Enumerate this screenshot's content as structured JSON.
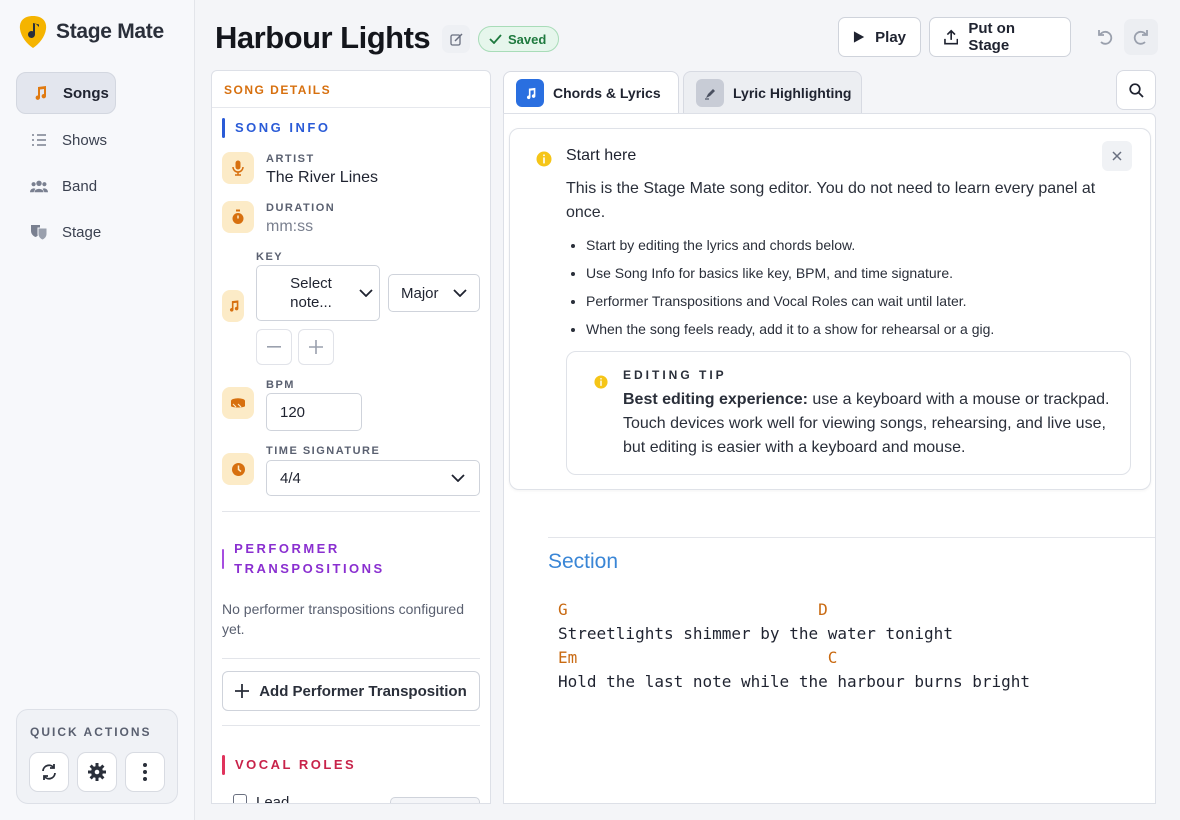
{
  "app": {
    "name": "Stage Mate",
    "colors": {
      "accent": "#d7700f",
      "logo": "#f5b400",
      "info": "#f5c518",
      "link": "#3a86d6"
    }
  },
  "sidebar": {
    "items": [
      {
        "label": "Songs",
        "icon": "music-note-icon",
        "active": true
      },
      {
        "label": "Shows",
        "icon": "list-icon",
        "active": false
      },
      {
        "label": "Band",
        "icon": "people-icon",
        "active": false
      },
      {
        "label": "Stage",
        "icon": "theater-masks-icon",
        "active": false
      }
    ],
    "quick_actions": {
      "title": "QUICK ACTIONS",
      "buttons": [
        "refresh-icon",
        "gear-icon",
        "more-vertical-icon"
      ]
    }
  },
  "header": {
    "title": "Harbour Lights",
    "saved_label": "Saved",
    "play_label": "Play",
    "stage_label": "Put on Stage"
  },
  "song_details": {
    "heading": "SONG DETAILS",
    "song_info": {
      "heading": "SONG INFO",
      "artist_label": "ARTIST",
      "artist_value": "The River Lines",
      "duration_label": "DURATION",
      "duration_placeholder": "mm:ss",
      "key_label": "KEY",
      "key_note": "Select note...",
      "key_mode": "Major",
      "bpm_label": "BPM",
      "bpm_value": "120",
      "time_sig_label": "TIME SIGNATURE",
      "time_sig_value": "4/4"
    },
    "performer": {
      "heading": "PERFORMER TRANSPOSITIONS",
      "empty": "No performer transpositions configured yet.",
      "add_label": "Add Performer Transposition"
    },
    "vocal": {
      "heading": "VOCAL ROLES",
      "first_role": "Lead"
    }
  },
  "tabs": [
    {
      "label": "Chords & Lyrics",
      "active": true
    },
    {
      "label": "Lyric Highlighting",
      "active": false
    }
  ],
  "callout": {
    "title": "Start here",
    "body": "This is the Stage Mate song editor. You do not need to learn every panel at once.",
    "bullets": [
      "Start by editing the lyrics and chords below.",
      "Use Song Info for basics like key, BPM, and time signature.",
      "Performer Transpositions and Vocal Roles can wait until later.",
      "When the song feels ready, add it to a show for rehearsal or a gig."
    ],
    "tip_label": "EDITING TIP",
    "tip_bold": "Best editing experience:",
    "tip_text": " use a keyboard with a mouse or trackpad. Touch devices work well for viewing songs, rehearsing, and live use, but editing is easier with a keyboard and mouse."
  },
  "song": {
    "section_name": "Section",
    "lines": [
      {
        "chords": "G                          D",
        "lyric": "Streetlights shimmer by the water tonight"
      },
      {
        "chords": "Em                          C",
        "lyric": "Hold the last note while the harbour burns bright"
      }
    ]
  }
}
